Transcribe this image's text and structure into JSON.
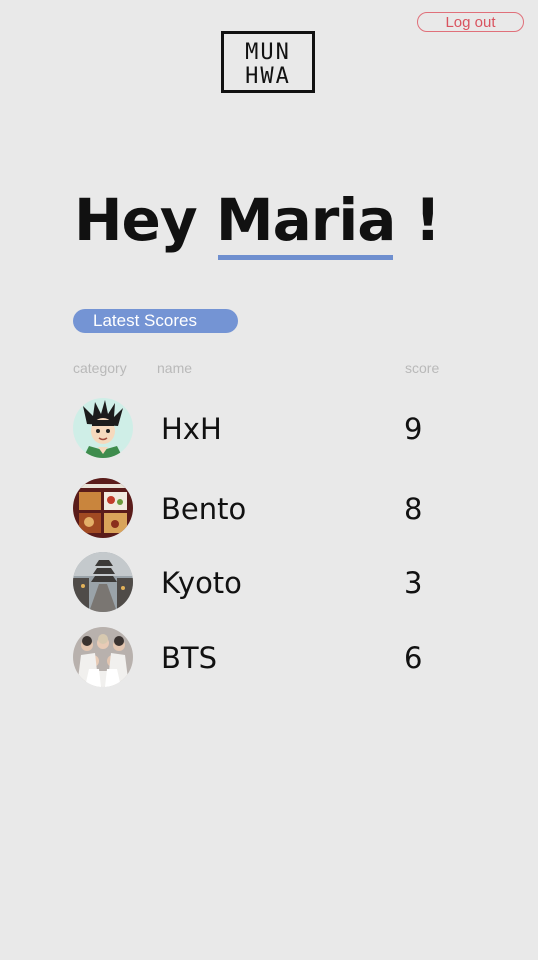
{
  "header": {
    "logout_label": "Log out",
    "logo_line1": "MUN",
    "logo_line2": "HWA"
  },
  "greeting": {
    "prefix": "Hey",
    "user_name": "Maria",
    "suffix": "!"
  },
  "scores": {
    "title": "Latest Scores",
    "columns": {
      "category": "category",
      "name": "name",
      "score": "score"
    },
    "items": [
      {
        "name": "HxH",
        "score": "9",
        "icon": "hxh-avatar-icon"
      },
      {
        "name": "Bento",
        "score": "8",
        "icon": "bento-avatar-icon"
      },
      {
        "name": "Kyoto",
        "score": "3",
        "icon": "kyoto-avatar-icon"
      },
      {
        "name": "BTS",
        "score": "6",
        "icon": "bts-avatar-icon"
      }
    ]
  },
  "colors": {
    "accent": "#7494d4",
    "logout": "#d9535f",
    "background": "#e9e9e9"
  }
}
